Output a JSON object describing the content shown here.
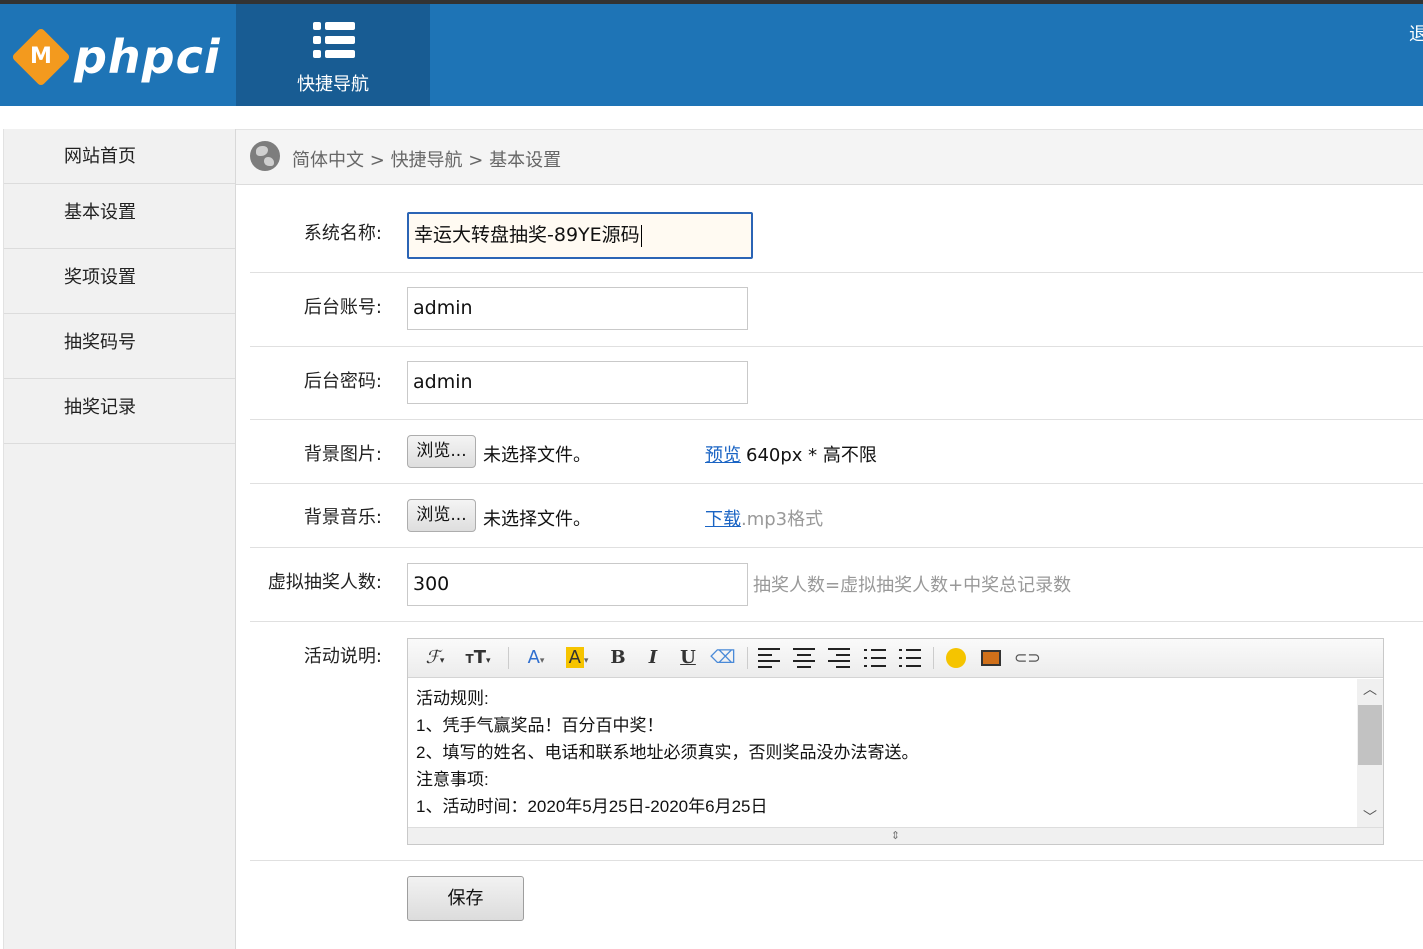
{
  "header": {
    "logo_text": "phpci",
    "logo_badge": "M",
    "nav_tab_label": "快捷导航",
    "logout_label": "退出",
    "colors": {
      "header_bg": "#1e74b6",
      "active_tab_bg": "#185c93",
      "logo_accent": "#f39a1e"
    }
  },
  "sidebar": {
    "items": [
      {
        "label": "网站首页"
      },
      {
        "label": "基本设置"
      },
      {
        "label": "奖项设置"
      },
      {
        "label": "抽奖码号"
      },
      {
        "label": "抽奖记录"
      }
    ]
  },
  "breadcrumb": {
    "icon": "globe-icon",
    "parts": [
      "简体中文",
      "快捷导航",
      "基本设置"
    ],
    "separator": ">"
  },
  "form": {
    "system_name": {
      "label": "系统名称:",
      "value": "幸运大转盘抽奖-89YE源码"
    },
    "admin_account": {
      "label": "后台账号:",
      "value": "admin"
    },
    "admin_password": {
      "label": "后台密码:",
      "value": "admin"
    },
    "background_image": {
      "label": "背景图片:",
      "browse_label": "浏览...",
      "no_file_text": "未选择文件。",
      "preview_link": "预览",
      "size_hint": "640px * 高不限"
    },
    "background_music": {
      "label": "背景音乐:",
      "browse_label": "浏览...",
      "no_file_text": "未选择文件。",
      "download_link": "下载",
      "format_hint": ".mp3格式"
    },
    "virtual_participants": {
      "label": "虚拟抽奖人数:",
      "value": "300",
      "hint": "抽奖人数=虚拟抽奖人数+中奖总记录数"
    },
    "activity_description": {
      "label": "活动说明:",
      "lines": [
        "活动规则:",
        "1、凭手气赢奖品！百分百中奖！",
        "2、填写的姓名、电话和联系地址必须真实，否则奖品没办法寄送。",
        "注意事项:",
        "1、活动时间：2020年5月25日-2020年6月25日"
      ]
    },
    "save_label": "保存"
  }
}
